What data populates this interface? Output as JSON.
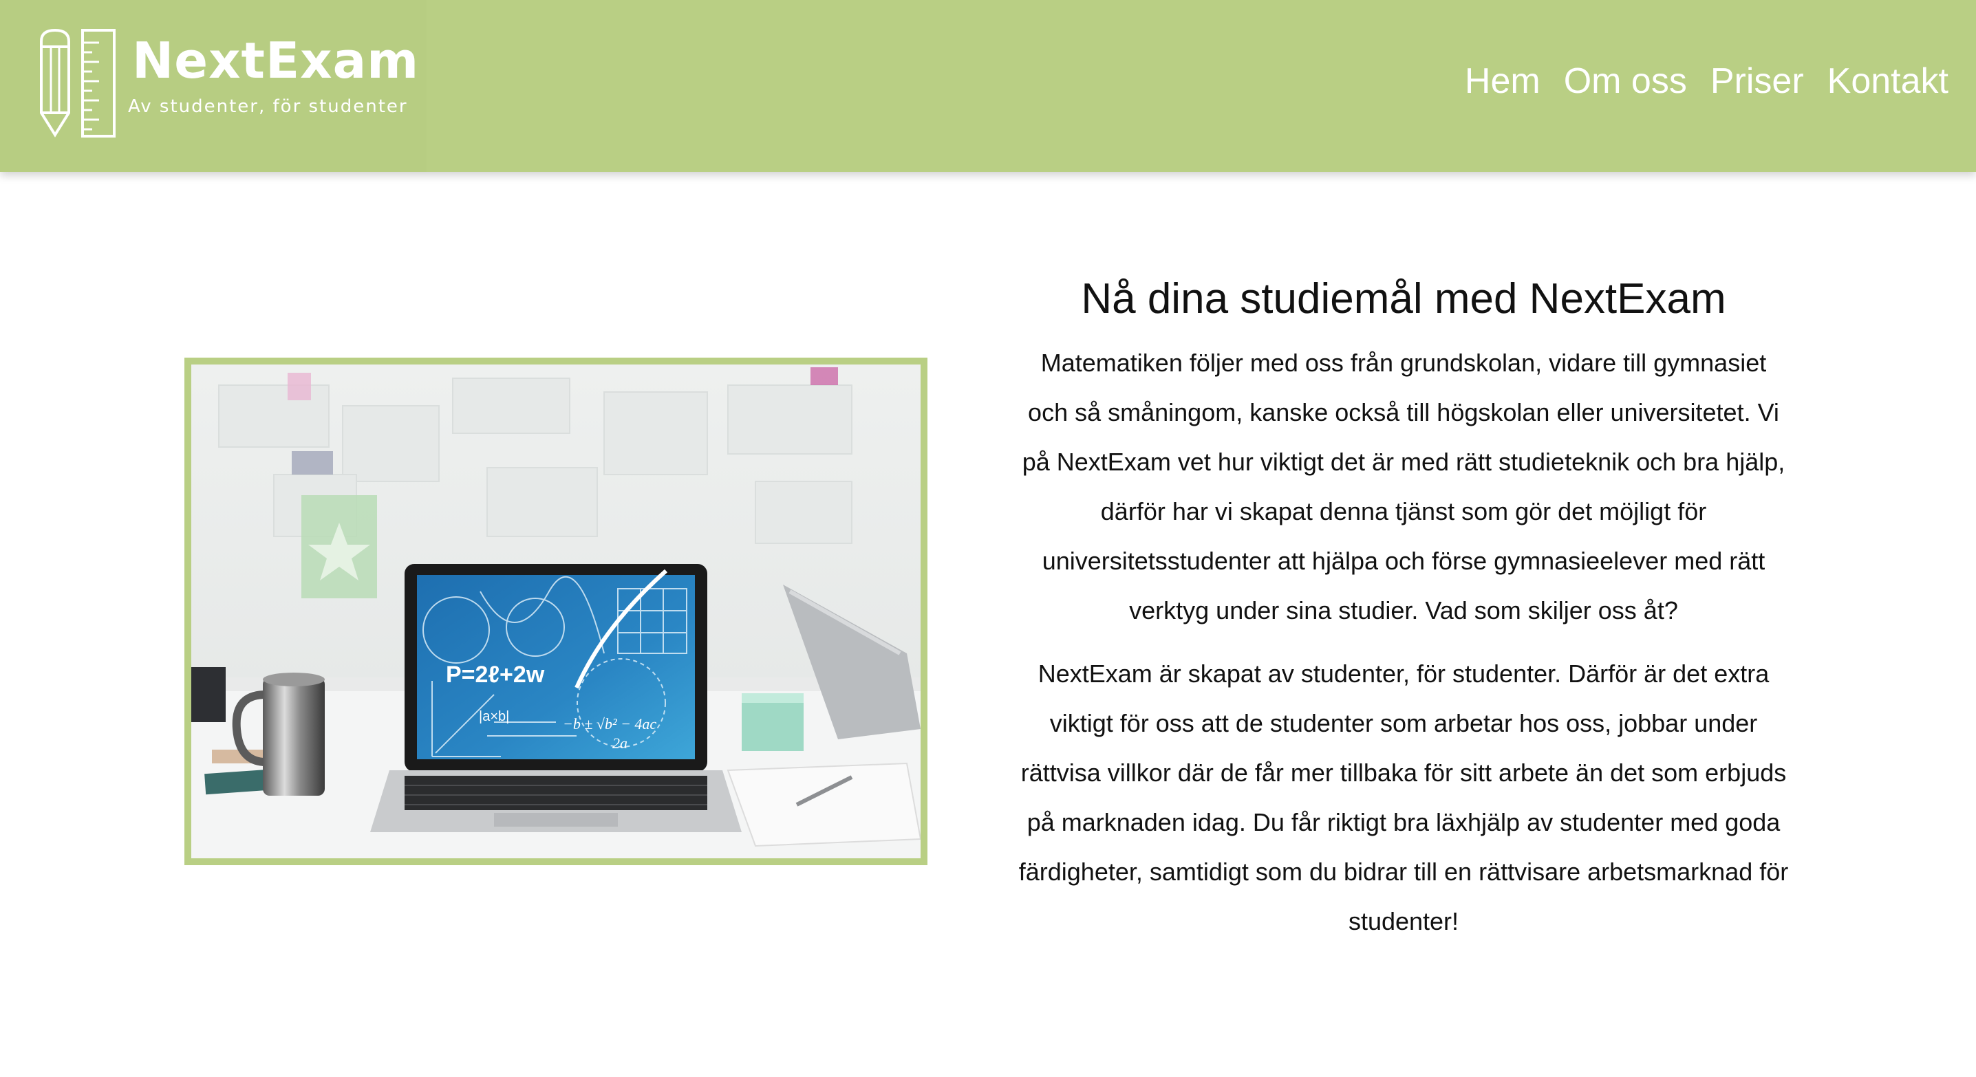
{
  "brand": {
    "name": "NextExam",
    "tagline": "Av studenter, för studenter"
  },
  "nav": {
    "items": [
      "Hem",
      "Om oss",
      "Priser",
      "Kontakt"
    ]
  },
  "hero_image": {
    "formula": "P=2ℓ+2w",
    "formula_quadratic": "−b ± √b² − 4ac",
    "formula_denominator": "2a",
    "label_abs": "|a×b|"
  },
  "main": {
    "heading": "Nå dina studiemål med NextExam",
    "paragraphs": [
      "Matematiken följer med oss från grundskolan, vidare till gymnasiet och så småningom, kanske också till högskolan eller universitetet. Vi på NextExam vet hur viktigt det är med rätt studieteknik och bra hjälp, därför har vi skapat denna tjänst som gör det möjligt för universitetsstudenter att hjälpa och förse gymnasieelever med rätt verktyg under sina studier. Vad som skiljer oss åt?",
      "NextExam är skapat av studenter, för studenter. Därför är det extra viktigt för oss att de studenter som arbetar hos oss, jobbar under rättvisa villkor där de får mer tillbaka för sitt arbete än det som erbjuds på marknaden idag. Du får riktigt bra läxhjälp av studenter med goda färdigheter, samtidigt som du bidrar till en rättvisare arbetsmarknad för studenter!"
    ]
  },
  "colors": {
    "header_green": "#b9cf84",
    "text": "#111111",
    "white": "#ffffff"
  }
}
